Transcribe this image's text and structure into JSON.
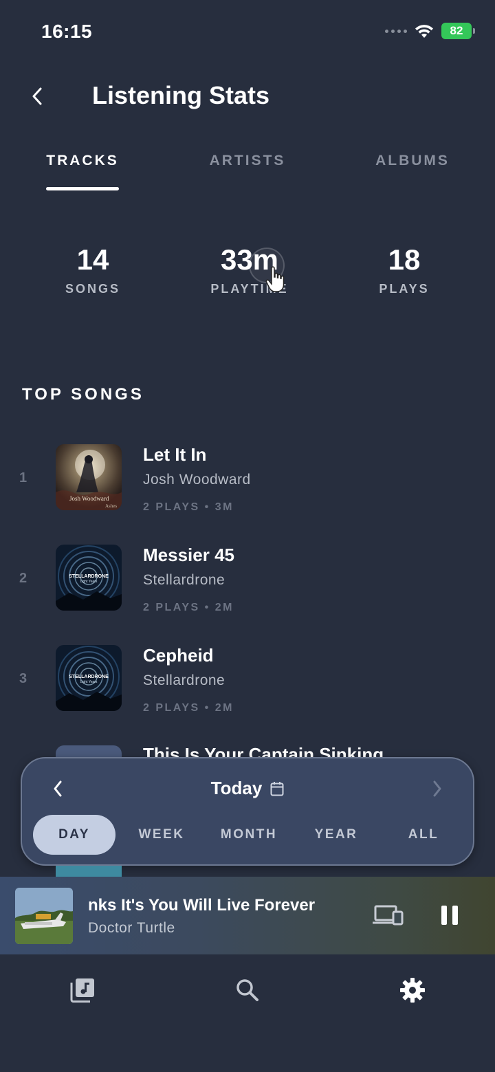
{
  "status_bar": {
    "time": "16:15",
    "battery": "82"
  },
  "header": {
    "title": "Listening Stats"
  },
  "tabs": [
    {
      "label": "TRACKS",
      "active": true
    },
    {
      "label": "ARTISTS",
      "active": false
    },
    {
      "label": "ALBUMS",
      "active": false
    }
  ],
  "stats": [
    {
      "value": "14",
      "label": "SONGS"
    },
    {
      "value": "33m",
      "label": "PLAYTIME"
    },
    {
      "value": "18",
      "label": "PLAYS"
    }
  ],
  "top_songs": {
    "title": "TOP SONGS",
    "items": [
      {
        "rank": "1",
        "title": "Let It In",
        "artist": "Josh Woodward",
        "meta": "2 PLAYS • 3M",
        "art_text": "Josh Woodward",
        "art_subtext": "Ashes"
      },
      {
        "rank": "2",
        "title": "Messier 45",
        "artist": "Stellardrone",
        "meta": "2 PLAYS • 2M",
        "art_text": "STELLARDRONE",
        "art_subtext": "Light Years"
      },
      {
        "rank": "3",
        "title": "Cepheid",
        "artist": "Stellardrone",
        "meta": "2 PLAYS • 2M",
        "art_text": "STELLARDRONE",
        "art_subtext": "Light Years"
      }
    ],
    "partial_item_title": "This Is Your Captain Sinking"
  },
  "range_selector": {
    "label": "Today",
    "options": [
      {
        "label": "DAY",
        "active": true
      },
      {
        "label": "WEEK",
        "active": false
      },
      {
        "label": "MONTH",
        "active": false
      },
      {
        "label": "YEAR",
        "active": false
      },
      {
        "label": "ALL",
        "active": false
      }
    ]
  },
  "now_playing": {
    "title": "nks It's You Will Live Forever",
    "artist": "Doctor Turtle"
  },
  "nav": {
    "items": [
      {
        "icon": "library-icon",
        "active": true
      },
      {
        "icon": "search-icon",
        "active": false
      },
      {
        "icon": "settings-icon",
        "active": false
      }
    ]
  },
  "colors": {
    "background": "#272e3e",
    "card": "#3a4763",
    "active_chip": "#c4cee2",
    "battery": "#34c759"
  }
}
